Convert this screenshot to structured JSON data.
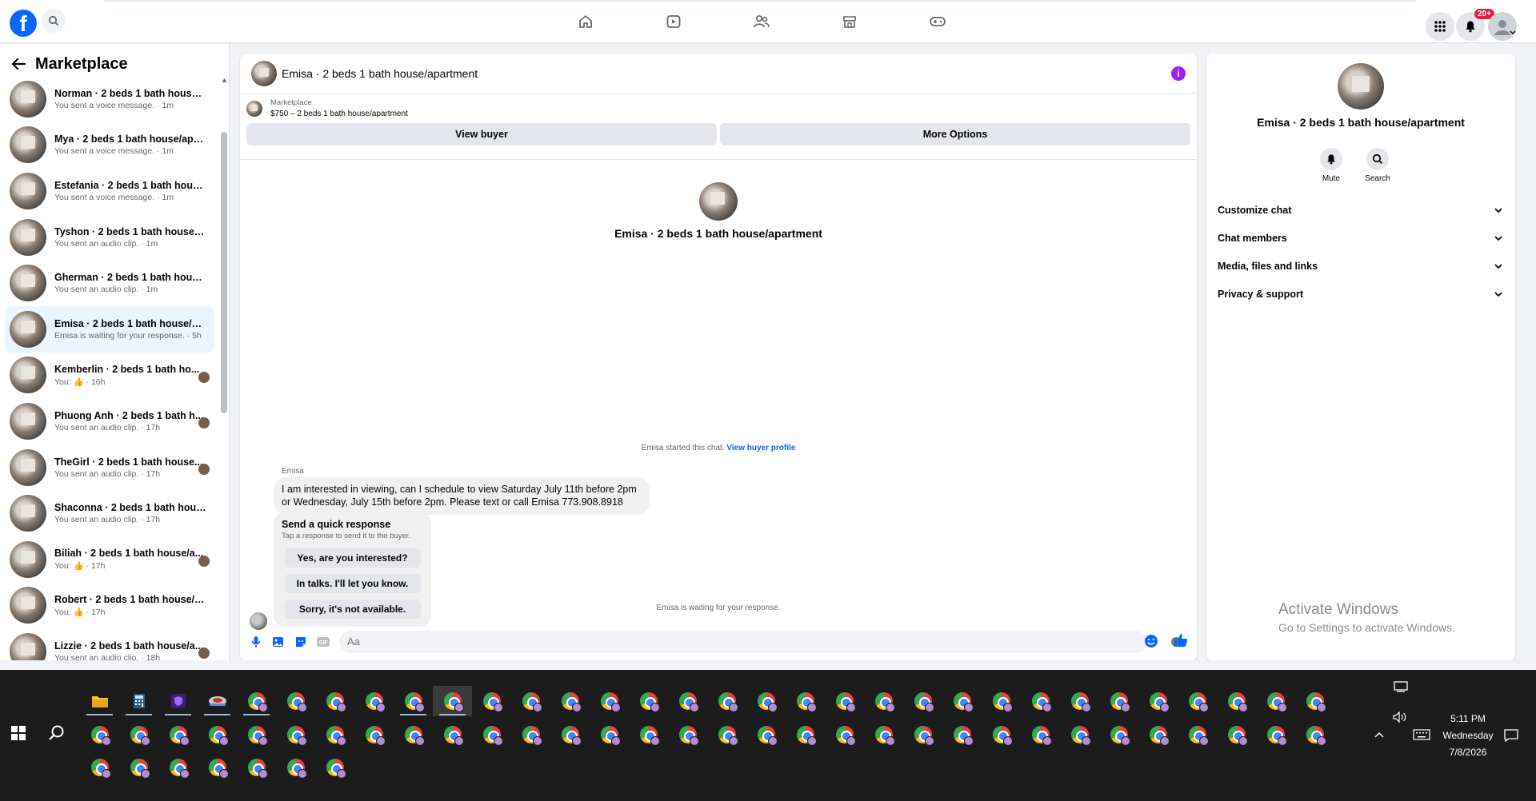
{
  "topnav": {
    "logo_letter": "f",
    "notification_count": "20+"
  },
  "sidebar": {
    "title": "Marketplace",
    "conversations": [
      {
        "name": "Norman · 2 beds 1 bath house/a...",
        "sub": "You sent a voice message. · 1m",
        "active": false,
        "mini": false
      },
      {
        "name": "Mya · 2 beds 1 bath house/apar...",
        "sub": "You sent a voice message. · 1m",
        "active": false,
        "mini": false
      },
      {
        "name": "Estefania · 2 beds 1 bath house/...",
        "sub": "You sent a voice message. · 1m",
        "active": false,
        "mini": false
      },
      {
        "name": "Tyshon · 2 beds 1 bath house/a...",
        "sub": "You sent an audio clip. · 1m",
        "active": false,
        "mini": false
      },
      {
        "name": "Gherman · 2 beds 1 bath house/...",
        "sub": "You sent an audio clip. · 1m",
        "active": false,
        "mini": false
      },
      {
        "name": "Emisa · 2 beds 1 bath house/apa...",
        "sub": "Emisa is waiting for your response. · 5h",
        "active": true,
        "mini": false
      },
      {
        "name": "Kemberlin · 2 beds 1 bath ho...",
        "sub": "You: 👍 · 16h",
        "active": false,
        "mini": true
      },
      {
        "name": "Phuong Anh · 2 beds 1 bath h...",
        "sub": "You sent an audio clip. · 17h",
        "active": false,
        "mini": true
      },
      {
        "name": "TheGirl · 2 beds 1 bath house...",
        "sub": "You sent an audio clip. · 17h",
        "active": false,
        "mini": true
      },
      {
        "name": "Shaconna · 2 beds 1 bath house...",
        "sub": "You sent an audio clip. · 17h",
        "active": false,
        "mini": false
      },
      {
        "name": "Biliah · 2 beds 1 bath house/a...",
        "sub": "You: 👍 · 17h",
        "active": false,
        "mini": true
      },
      {
        "name": "Robert · 2 beds 1 bath house/ap...",
        "sub": "You: 👍 · 17h",
        "active": false,
        "mini": false
      },
      {
        "name": "Lizzie · 2 beds 1 bath house/a...",
        "sub": "You sent an audio clip. · 18h",
        "active": false,
        "mini": true
      }
    ]
  },
  "chat": {
    "title": "Emisa · 2 beds 1 bath house/apartment",
    "marketplace_label": "Marketplace",
    "listing": "$750 – 2 beds 1 bath house/apartment",
    "view_buyer": "View buyer",
    "more_options": "More Options",
    "intro_name": "Emisa · 2 beds 1 bath house/apartment",
    "started_text": "Emisa started this chat.",
    "view_buyer_profile": "View buyer profile",
    "sender": "Emisa",
    "message": "I am interested in viewing, can I schedule to view Saturday July 11th before 2pm or Wednesday, July 15th before 2pm. Please text or call Emisa 773.908.8918",
    "quick_title": "Send a quick response",
    "quick_sub": "Tap a response to send it to the buyer.",
    "quick_responses": [
      "Yes, are you interested?",
      "In talks. I'll let you know.",
      "Sorry, it's not available."
    ],
    "waiting": "Emisa is waiting for your response.",
    "input_placeholder": "Aa"
  },
  "rpanel": {
    "title": "Emisa · 2 beds 1 bath house/apartment",
    "mute": "Mute",
    "search": "Search",
    "sections": [
      "Customize chat",
      "Chat members",
      "Media, files and links",
      "Privacy & support"
    ]
  },
  "watermark": {
    "line1": "Activate Windows",
    "line2": "Go to Settings to activate Windows."
  },
  "taskbar": {
    "time": "5:11 PM",
    "day": "Wednesday",
    "date": "7/8/2026"
  }
}
